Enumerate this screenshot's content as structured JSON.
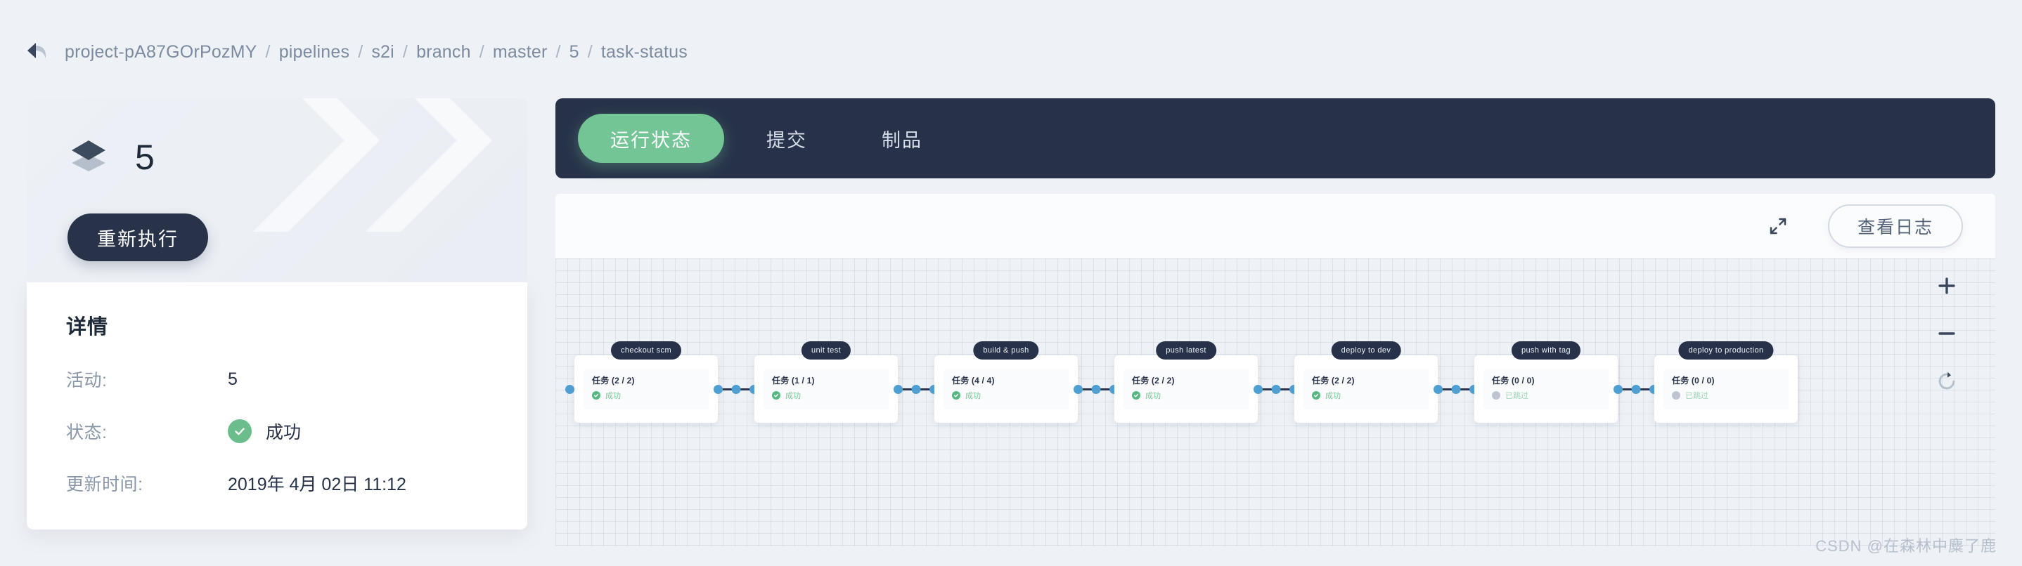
{
  "breadcrumb": {
    "back_icon": "back-arrow-icon",
    "separator": "/",
    "items": [
      {
        "label": "project-pA87GOrPozMY"
      },
      {
        "label": "pipelines"
      },
      {
        "label": "s2i"
      },
      {
        "label": "branch"
      },
      {
        "label": "master"
      },
      {
        "label": "5"
      },
      {
        "label": "task-status"
      }
    ]
  },
  "hero": {
    "icon": "layers-icon",
    "number": "5",
    "rerun_label": "重新执行"
  },
  "details": {
    "title": "详情",
    "rows": [
      {
        "label": "活动:",
        "value": "5",
        "icon": ""
      },
      {
        "label": "状态:",
        "value": "成功",
        "icon": "success-check-icon"
      },
      {
        "label": "更新时间:",
        "value": "2019年 4月 02日 11:12",
        "icon": ""
      }
    ]
  },
  "tabs": [
    {
      "label": "运行状态",
      "active": true
    },
    {
      "label": "提交",
      "active": false
    },
    {
      "label": "制品",
      "active": false
    }
  ],
  "toolbar": {
    "expand_icon": "fullscreen-expand-icon",
    "logs_label": "查看日志"
  },
  "canvas": {
    "zoom_in_icon": "plus-icon",
    "zoom_out_icon": "minus-icon",
    "reset_icon": "refresh-icon",
    "stages": [
      {
        "name": "checkout scm",
        "tasks": "任务 (2 / 2)",
        "status": "成功",
        "state": "success"
      },
      {
        "name": "unit test",
        "tasks": "任务 (1 / 1)",
        "status": "成功",
        "state": "success"
      },
      {
        "name": "build & push",
        "tasks": "任务 (4 / 4)",
        "status": "成功",
        "state": "success"
      },
      {
        "name": "push latest",
        "tasks": "任务 (2 / 2)",
        "status": "成功",
        "state": "success"
      },
      {
        "name": "deploy to dev",
        "tasks": "任务 (2 / 2)",
        "status": "成功",
        "state": "success"
      },
      {
        "name": "push with tag",
        "tasks": "任务 (0 / 0)",
        "status": "已跳过",
        "state": "skipped"
      },
      {
        "name": "deploy to production",
        "tasks": "任务 (0 / 0)",
        "status": "已跳过",
        "state": "skipped"
      }
    ]
  },
  "watermark": {
    "text": "CSDN @在森林中麋了鹿"
  },
  "colors": {
    "page_bg": "#eef1f5",
    "dark": "#27324a",
    "accent_green": "#74c596",
    "success_green": "#55b97f",
    "skipped_gray": "#bcc5d1",
    "node_blue": "#4e9fd4",
    "muted_text": "#8a97ab"
  }
}
